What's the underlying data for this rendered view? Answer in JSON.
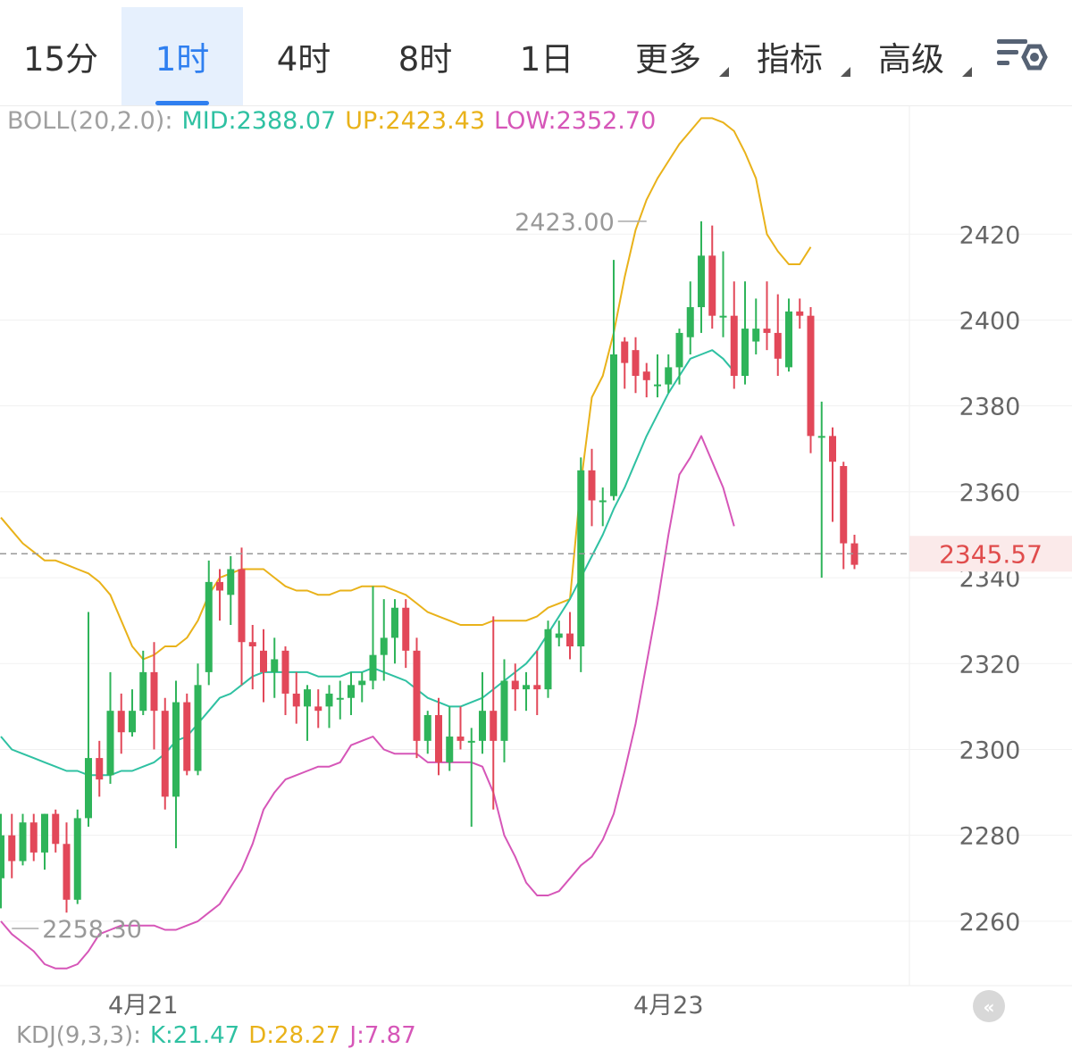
{
  "tabs": [
    {
      "label": "15分",
      "active": false,
      "dropdown": false
    },
    {
      "label": "1时",
      "active": true,
      "dropdown": false
    },
    {
      "label": "4时",
      "active": false,
      "dropdown": false
    },
    {
      "label": "8时",
      "active": false,
      "dropdown": false
    },
    {
      "label": "1日",
      "active": false,
      "dropdown": false
    },
    {
      "label": "更多",
      "active": false,
      "dropdown": true
    },
    {
      "label": "指标",
      "active": false,
      "dropdown": true
    },
    {
      "label": "高级",
      "active": false,
      "dropdown": true
    }
  ],
  "settings_icon": "chart-settings-icon",
  "boll_legend": {
    "name": "BOLL(20,2.0):",
    "mid": "MID:2388.07",
    "up": "UP:2423.43",
    "low": "LOW:2352.70"
  },
  "kdj_legend": {
    "name": "KDJ(9,3,3):",
    "k": "K:21.47",
    "d": "D:28.27",
    "j": "J:7.87"
  },
  "colors": {
    "up_candle": "#2fb45a",
    "down_candle": "#e24859",
    "boll_mid": "#2fc1a2",
    "boll_up": "#e9b21a",
    "boll_low": "#d656b8",
    "price_line": "#999999",
    "price_label": "#e04c4c",
    "tab_active": "#2f7ff0"
  },
  "chart_data": {
    "type": "candlestick",
    "title": "",
    "ylim": [
      2245,
      2450
    ],
    "yticks": [
      2260,
      2280,
      2300,
      2320,
      2340,
      2360,
      2380,
      2400,
      2420
    ],
    "x_labels": [
      {
        "label": "4月21",
        "index": 13
      },
      {
        "label": "4月23",
        "index": 61
      }
    ],
    "current_price": 2345.57,
    "current_price_label": "2345.57",
    "annotations": [
      {
        "label": "2423.00",
        "value": 2423.0,
        "index": 59,
        "side": "left"
      },
      {
        "label": "2258.30",
        "value": 2258.3,
        "index": 1,
        "side": "right"
      }
    ],
    "candles": [
      [
        2270,
        2280,
        2263,
        2285
      ],
      [
        2280,
        2274,
        2270,
        2285
      ],
      [
        2274,
        2283,
        2273,
        2285
      ],
      [
        2283,
        2276,
        2274,
        2285
      ],
      [
        2276,
        2285,
        2272,
        2285
      ],
      [
        2285,
        2278,
        2276,
        2286
      ],
      [
        2278,
        2265,
        2262,
        2283
      ],
      [
        2265,
        2284,
        2264,
        2286
      ],
      [
        2284,
        2298,
        2282,
        2332
      ],
      [
        2298,
        2293,
        2289,
        2302
      ],
      [
        2294,
        2309,
        2292,
        2318
      ],
      [
        2309,
        2304,
        2299,
        2313
      ],
      [
        2304,
        2309,
        2303,
        2314
      ],
      [
        2309,
        2318,
        2308,
        2323
      ],
      [
        2318,
        2309,
        2300,
        2325
      ],
      [
        2309,
        2289,
        2286,
        2312
      ],
      [
        2289,
        2311,
        2277,
        2316
      ],
      [
        2311,
        2295,
        2294,
        2313
      ],
      [
        2295,
        2315,
        2294,
        2320
      ],
      [
        2318,
        2339,
        2315,
        2344
      ],
      [
        2339,
        2337,
        2330,
        2342
      ],
      [
        2336,
        2342,
        2329,
        2345
      ],
      [
        2342,
        2325,
        2315,
        2347
      ],
      [
        2325,
        2324,
        2314,
        2329
      ],
      [
        2323,
        2318,
        2311,
        2328
      ],
      [
        2318,
        2321,
        2312,
        2326
      ],
      [
        2323,
        2313,
        2308,
        2324
      ],
      [
        2313,
        2310,
        2306,
        2318
      ],
      [
        2310,
        2314,
        2302,
        2315
      ],
      [
        2310,
        2309,
        2305,
        2314
      ],
      [
        2310,
        2313,
        2305,
        2315
      ],
      [
        2312,
        2312,
        2307,
        2316
      ],
      [
        2312,
        2315,
        2308,
        2318
      ],
      [
        2315,
        2316,
        2311,
        2318
      ],
      [
        2316,
        2322,
        2314,
        2338
      ],
      [
        2322,
        2326,
        2316,
        2335
      ],
      [
        2326,
        2333,
        2320,
        2335
      ],
      [
        2333,
        2323,
        2319,
        2335
      ],
      [
        2323,
        2302,
        2298,
        2326
      ],
      [
        2302,
        2308,
        2299,
        2309
      ],
      [
        2308,
        2297,
        2294,
        2312
      ],
      [
        2297,
        2303,
        2295,
        2310
      ],
      [
        2303,
        2302,
        2300,
        2310
      ],
      [
        2302,
        2302,
        2282,
        2305
      ],
      [
        2302,
        2309,
        2299,
        2318
      ],
      [
        2309,
        2302,
        2286,
        2331
      ],
      [
        2302,
        2316,
        2297,
        2321
      ],
      [
        2316,
        2314,
        2309,
        2320
      ],
      [
        2314,
        2315,
        2309,
        2318
      ],
      [
        2315,
        2314,
        2308,
        2323
      ],
      [
        2314,
        2328,
        2312,
        2330
      ],
      [
        2326,
        2327,
        2324,
        2330
      ],
      [
        2327,
        2324,
        2321,
        2332
      ],
      [
        2324,
        2365,
        2318,
        2368
      ],
      [
        2365,
        2358,
        2352,
        2370
      ],
      [
        2358,
        2358,
        2352,
        2361
      ],
      [
        2359,
        2392,
        2358,
        2414
      ],
      [
        2395,
        2390,
        2384,
        2396
      ],
      [
        2393,
        2387,
        2383,
        2396
      ],
      [
        2388,
        2386,
        2382,
        2390
      ],
      [
        2385,
        2385,
        2382,
        2392
      ],
      [
        2385,
        2389,
        2383,
        2392
      ],
      [
        2389,
        2397,
        2385,
        2398
      ],
      [
        2396,
        2403,
        2392,
        2409
      ],
      [
        2403,
        2415,
        2397,
        2423
      ],
      [
        2415,
        2401,
        2398,
        2422
      ],
      [
        2401,
        2401,
        2396,
        2416
      ],
      [
        2401,
        2387,
        2384,
        2409
      ],
      [
        2387,
        2398,
        2385,
        2409
      ],
      [
        2395,
        2398,
        2392,
        2405
      ],
      [
        2398,
        2397,
        2393,
        2409
      ],
      [
        2397,
        2391,
        2387,
        2406
      ],
      [
        2389,
        2402,
        2388,
        2405
      ],
      [
        2402,
        2401,
        2398,
        2405
      ],
      [
        2401,
        2373,
        2369,
        2403
      ],
      [
        2373,
        2373,
        2340,
        2381
      ],
      [
        2373,
        2367,
        2353,
        2375
      ],
      [
        2366,
        2348,
        2342,
        2367
      ],
      [
        2348,
        2343,
        2342,
        2350
      ]
    ],
    "series": [
      {
        "name": "UP",
        "values": [
          2354,
          2351,
          2348,
          2346,
          2344,
          2344,
          2343,
          2342,
          2341,
          2339,
          2336,
          2330,
          2324,
          2321,
          2322,
          2324,
          2324,
          2326,
          2330,
          2336,
          2340,
          2341,
          2342,
          2342,
          2342,
          2340,
          2338,
          2337,
          2337,
          2336,
          2336,
          2337,
          2337,
          2338,
          2338,
          2338,
          2337,
          2336,
          2334,
          2332,
          2331,
          2330,
          2329,
          2329,
          2329,
          2330,
          2330,
          2330,
          2330,
          2331,
          2333,
          2334,
          2335,
          2362,
          2382,
          2387,
          2397,
          2410,
          2421,
          2428,
          2433,
          2437,
          2441,
          2444,
          2447,
          2447,
          2446,
          2444,
          2439,
          2433,
          2420,
          2416,
          2413,
          2413,
          2417
        ]
      },
      {
        "name": "MID",
        "values": [
          2303,
          2300,
          2299,
          2298,
          2297,
          2296,
          2295,
          2295,
          2294,
          2294,
          2294,
          2295,
          2295,
          2296,
          2297,
          2299,
          2302,
          2303,
          2306,
          2309,
          2312,
          2313,
          2315,
          2317,
          2318,
          2318,
          2318,
          2318,
          2318,
          2317,
          2317,
          2317,
          2318,
          2318,
          2319,
          2318,
          2317,
          2316,
          2314,
          2312,
          2311,
          2310,
          2310,
          2311,
          2312,
          2314,
          2316,
          2318,
          2320,
          2323,
          2327,
          2331,
          2335,
          2340,
          2345,
          2350,
          2356,
          2361,
          2367,
          2373,
          2378,
          2383,
          2387,
          2391,
          2392,
          2393,
          2391,
          2388
        ]
      },
      {
        "name": "LOW",
        "values": [
          2260,
          2257,
          2255,
          2253,
          2250,
          2249,
          2249,
          2250,
          2253,
          2257,
          2258,
          2259,
          2259,
          2259,
          2259,
          2258,
          2258,
          2259,
          2260,
          2262,
          2264,
          2268,
          2272,
          2278,
          2286,
          2290,
          2293,
          2294,
          2295,
          2296,
          2296,
          2297,
          2301,
          2302,
          2303,
          2300,
          2299,
          2299,
          2299,
          2297,
          2297,
          2297,
          2297,
          2297,
          2296,
          2290,
          2280,
          2275,
          2269,
          2266,
          2266,
          2267,
          2270,
          2273,
          2275,
          2279,
          2285,
          2295,
          2306,
          2320,
          2334,
          2350,
          2364,
          2368,
          2373,
          2367,
          2361,
          2352
        ]
      }
    ]
  }
}
